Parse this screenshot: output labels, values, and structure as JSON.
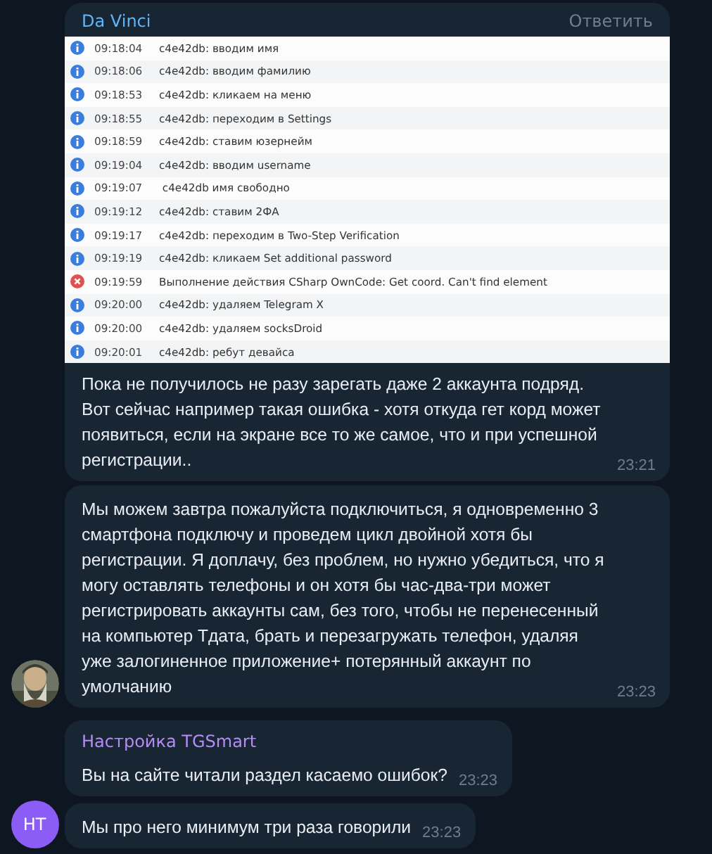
{
  "messages": [
    {
      "kind": "log",
      "sender": "Da Vinci",
      "reply_action": "Ответить",
      "log": [
        {
          "kind": "info",
          "time": "09:18:04",
          "text": "c4e42db: вводим имя"
        },
        {
          "kind": "info",
          "time": "09:18:06",
          "text": "c4e42db: вводим фамилию"
        },
        {
          "kind": "info",
          "time": "09:18:53",
          "text": "c4e42db: кликаем на меню"
        },
        {
          "kind": "info",
          "time": "09:18:55",
          "text": "c4e42db: переходим в Settings"
        },
        {
          "kind": "info",
          "time": "09:18:59",
          "text": "c4e42db: ставим юзернейм"
        },
        {
          "kind": "info",
          "time": "09:19:04",
          "text": "c4e42db: вводим username"
        },
        {
          "kind": "info",
          "time": "09:19:07",
          "text": " c4e42db имя свободно"
        },
        {
          "kind": "info",
          "time": "09:19:12",
          "text": "c4e42db: ставим 2ФА"
        },
        {
          "kind": "info",
          "time": "09:19:17",
          "text": "c4e42db: переходим в Two-Step Verification"
        },
        {
          "kind": "info",
          "time": "09:19:19",
          "text": "c4e42db: кликаем Set additional password"
        },
        {
          "kind": "error",
          "time": "09:19:59",
          "text": "Выполнение действия CSharp OwnCode: Get coord. Can't find element"
        },
        {
          "kind": "info",
          "time": "09:20:00",
          "text": "c4e42db: удаляем Telegram X"
        },
        {
          "kind": "info",
          "time": "09:20:00",
          "text": "c4e42db: удаляем socksDroid"
        },
        {
          "kind": "info",
          "time": "09:20:01",
          "text": "c4e42db: ребут девайса"
        }
      ],
      "text": "Пока не получилось не разу зарегать даже 2 аккаунта подряд. Вот сейчас например такая ошибка - хотя откуда гет корд может появиться, если на экране все то же самое, что и при успешной регистрации..",
      "time": "23:21"
    },
    {
      "kind": "text",
      "text": "Мы можем завтра пожалуйста подключиться, я одновременно 3 смартфона подключу и проведем цикл двойной хотя бы регистрации. Я доплачу, без проблем, но нужно убедиться, что я могу оставлять телефоны и он хотя бы час-два-три может регистрировать аккаунты сам, без того, чтобы не перенесенный на компьютер Тдата, брать и перезагружать телефон, удаляя уже залогиненное приложение+ потерянный аккаунт по умолчанию",
      "time": "23:23"
    },
    {
      "kind": "text",
      "sender": "Настройка TGSmart",
      "text": "Вы на сайте читали раздел касаемо ошибок?",
      "time": "23:23"
    },
    {
      "kind": "text",
      "avatar": {
        "kind": "initials",
        "initials": "НТ",
        "color": "#8b5cf6"
      },
      "text": "Мы про него минимум три раза говорили",
      "time": "23:23"
    }
  ]
}
